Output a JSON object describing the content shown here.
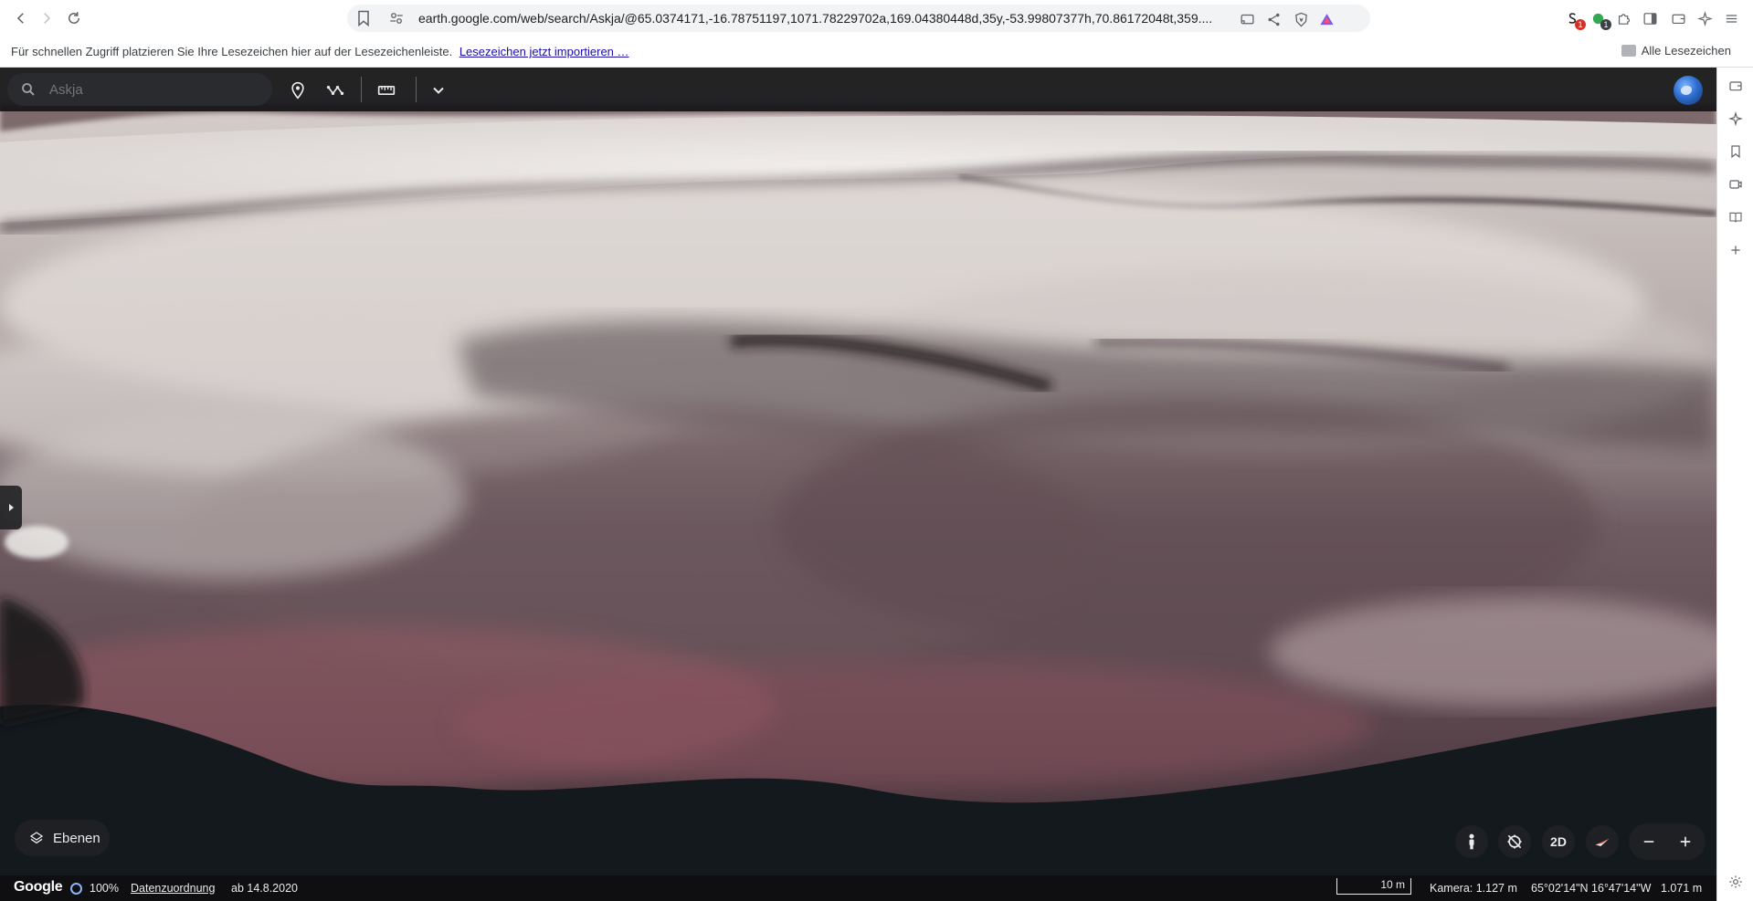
{
  "browser": {
    "url": "earth.google.com/web/search/Askja/@65.0374171,-16.78751197,1071.78229702a,169.04380448d,35y,-53.99807377h,70.86172048t,359....",
    "extensions": [
      {
        "name": "extension-one-icon",
        "badge": "1"
      },
      {
        "name": "extension-two-icon",
        "badge": "1"
      }
    ],
    "bookmarks_bar": {
      "hint": "Für schnellen Zugriff platzieren Sie Ihre Lesezeichen hier auf der Lesezeichenleiste.",
      "import_link": "Lesezeichen jetzt importieren …",
      "all_bookmarks": "Alle Lesezeichen"
    }
  },
  "earth": {
    "search": {
      "placeholder": "Askja",
      "value": ""
    },
    "layers_label": "Ebenen",
    "view_mode_label": "2D",
    "status": {
      "logo": "Google",
      "load_percent": "100%",
      "attribution": "Datenzuordnung",
      "imagery_date": "ab 14.8.2020",
      "scale": "10 m",
      "camera": "Kamera: 1.127 m",
      "coordinates": "65°02'14\"N 16°47'14\"W",
      "elevation": "1.071 m"
    }
  },
  "colors": {
    "accent": "#8ab4f8",
    "toolbar_dark": "#141416",
    "terrain_snow": "#e4dfdc",
    "terrain_rock": "#4a3a40",
    "terrain_red": "#9a5a66"
  }
}
